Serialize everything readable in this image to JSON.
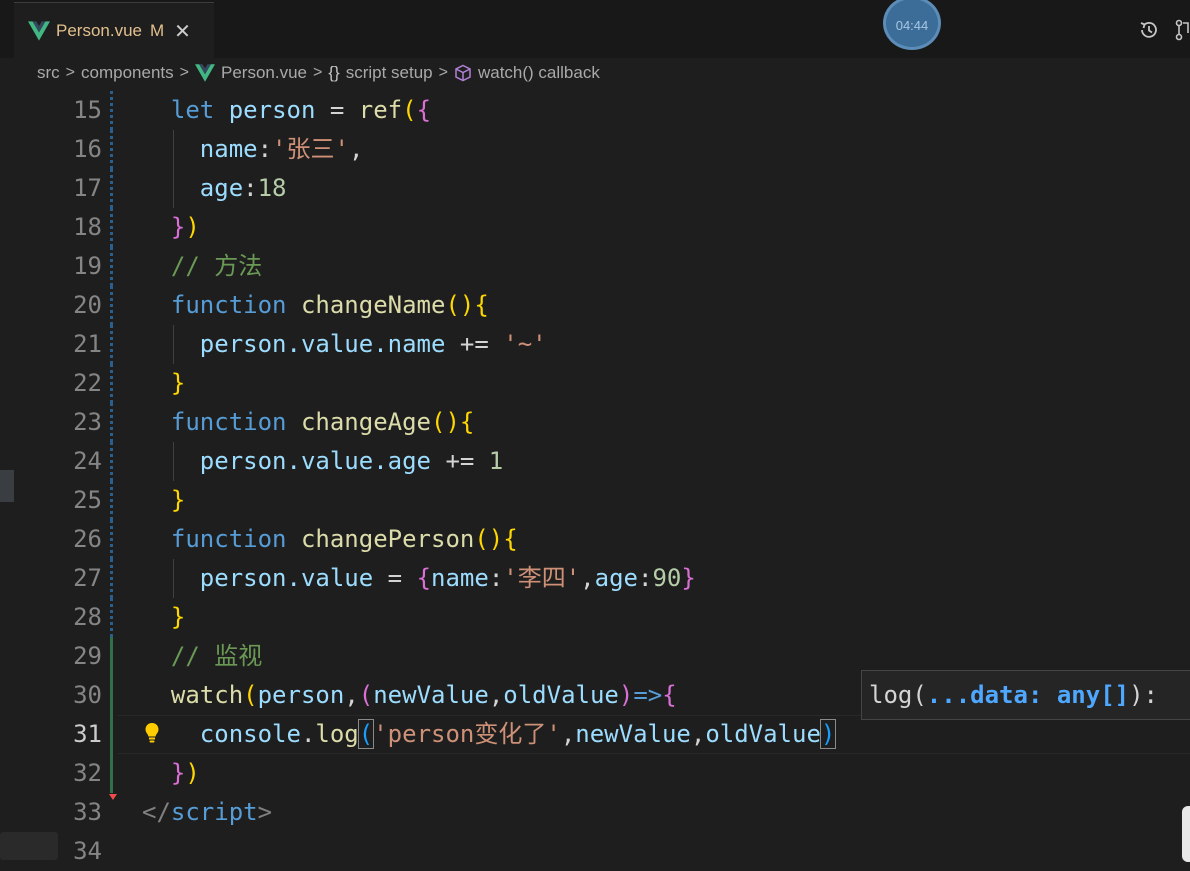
{
  "tab": {
    "label": "Person.vue",
    "modified": "M",
    "close": "✕"
  },
  "timer": "04:44",
  "breadcrumb": {
    "src": "src",
    "components": "components",
    "file": "Person.vue",
    "setup": "script setup",
    "setup_braces": "{}",
    "callback": "watch() callback"
  },
  "lines": [
    {
      "no": "15"
    },
    {
      "no": "16"
    },
    {
      "no": "17"
    },
    {
      "no": "18"
    },
    {
      "no": "19"
    },
    {
      "no": "20"
    },
    {
      "no": "21"
    },
    {
      "no": "22"
    },
    {
      "no": "23"
    },
    {
      "no": "24"
    },
    {
      "no": "25"
    },
    {
      "no": "26"
    },
    {
      "no": "27"
    },
    {
      "no": "28"
    },
    {
      "no": "29"
    },
    {
      "no": "30"
    },
    {
      "no": "31"
    },
    {
      "no": "32"
    },
    {
      "no": "33"
    },
    {
      "no": "34"
    }
  ],
  "code": {
    "l15_let": "let",
    "l15_person": "person",
    "l15_eq": " = ",
    "l15_ref": "ref",
    "l15_po": "(",
    "l15_bo": "{",
    "l16_key": "name",
    "l16_colon": ":",
    "l16_val": "'张三'",
    "l16_comma": ",",
    "l17_key": "age",
    "l17_colon": ":",
    "l17_val": "18",
    "l18_bc": "}",
    "l18_pc": ")",
    "l19_comment": "// 方法",
    "l20_function": "function",
    "l20_name": "changeName",
    "l20_parens": "()",
    "l20_bo": "{",
    "l21_a": "person",
    "l21_b": ".value",
    "l21_c": ".name",
    "l21_op": " += ",
    "l21_str": "'~'",
    "l22_bc": "}",
    "l23_function": "function",
    "l23_name": "changeAge",
    "l23_parens": "()",
    "l23_bo": "{",
    "l24_a": "person",
    "l24_b": ".value",
    "l24_c": ".age",
    "l24_op": " += ",
    "l24_num": "1",
    "l25_bc": "}",
    "l26_function": "function",
    "l26_name": "changePerson",
    "l26_parens": "()",
    "l26_bo": "{",
    "l27_a": "person",
    "l27_b": ".value",
    "l27_op": " = ",
    "l27_bo": "{",
    "l27_k1": "name",
    "l27_c1": ":",
    "l27_s": "'李四'",
    "l27_comma": ",",
    "l27_k2": "age",
    "l27_c2": ":",
    "l27_n": "90",
    "l27_bc": "}",
    "l28_bc": "}",
    "l29_comment": "// 监视",
    "l30_watch": "watch",
    "l30_po": "(",
    "l30_person": "person",
    "l30_comma": ",",
    "l30_po2": "(",
    "l30_nv": "newValue",
    "l30_comma2": ",",
    "l30_ov": "oldValue",
    "l30_pc2": ")",
    "l30_arrow": "=>",
    "l30_bo": "{",
    "l31_console": "console",
    "l31_dot": ".",
    "l31_log": "log",
    "l31_po": "(",
    "l31_str": "'person变化了'",
    "l31_comma": ",",
    "l31_nv": "newValue",
    "l31_comma2": ",",
    "l31_ov": "oldValue",
    "l31_pc": ")",
    "l32_bc": "}",
    "l32_pc": ")",
    "l33_open": "</",
    "l33_tag": "script",
    "l33_close": ">"
  },
  "hint": {
    "pre": "log(",
    "param": "...data: any[]",
    "post": "):"
  }
}
